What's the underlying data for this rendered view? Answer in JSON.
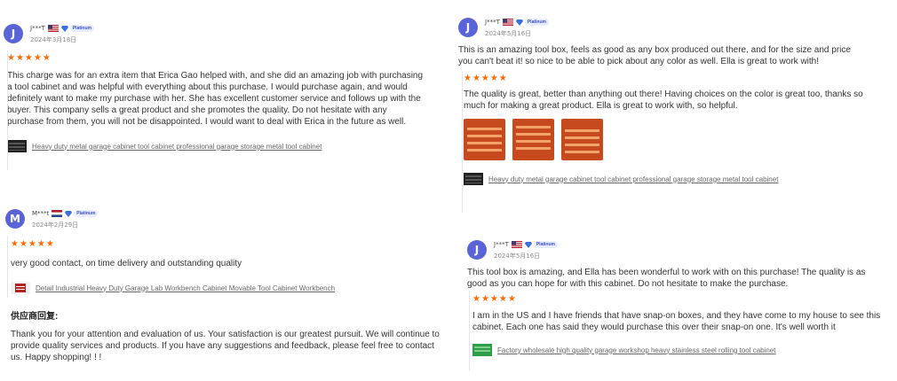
{
  "reviews": [
    {
      "id": "r1",
      "avatar_letter": "J",
      "name": "J***T",
      "flag": "us-flag",
      "badge": "Platinum",
      "date": "2024年3月18日",
      "stars": "★★★★★",
      "comment": "This charge was for an extra item that Erica Gao helped with, and she did an amazing job with purchasing a tool cabinet and was helpful with everything about this purchase. I would purchase again, and would definitely want to make my purchase with her. She has excellent customer service and follows up with the buyer. This company sells a great product and she promotes the quality. Do not hesitate with any purchase from them, you will not be disappointed. I would want to deal with Erica in the future as well.",
      "product": "Heavy duty metal garage cabinet tool cabinet professional garage storage metal tool cabinet"
    },
    {
      "id": "r2",
      "avatar_letter": "J",
      "name": "J***T",
      "flag": "us-flag",
      "badge": "Platinum",
      "date": "2024年5月16日",
      "supplier_comment": "This is an amazing tool box, feels as good as any box produced out there, and for the size and price you can't beat it! so nice to be able to pick about any color as well. Ella is great to work with!",
      "stars": "★★★★★",
      "comment": "The quality is great, better than anything out there! Having choices on the color is great too, thanks so much for making a great product. Ella is great to work with, so helpful.",
      "product": "Heavy duty metal garage cabinet tool cabinet professional garage storage metal tool cabinet"
    },
    {
      "id": "r3",
      "avatar_letter": "M",
      "name": "M***t",
      "flag": "nl-flag",
      "badge": "Platinum",
      "date": "2024年2月29日",
      "stars": "★★★★★",
      "comment": "very good contact, on time delivery and outstanding quality",
      "product": "Detail Industrial Heavy Duty Garage Lab Workbench Cabinet Movable Tool Cabinet Workbench",
      "supplier_reply_title": "供应商回复:",
      "supplier_reply": "Thank you for your attention and evaluation of us. Your satisfaction is our greatest pursuit. We will continue to provide quality services and products. If you have any suggestions and feedback, please feel free to contact us. Happy shopping! ! !"
    },
    {
      "id": "r4",
      "avatar_letter": "J",
      "name": "J***T",
      "flag": "us-flag",
      "badge": "Platinum",
      "date": "2024年5月16日",
      "supplier_comment": "This tool box is amazing, and Ella has been wonderful to work with on this purchase! The quality is as good as you can hope for with this cabinet. Do not hesitate to make the purchase.",
      "stars": "★★★★★",
      "comment": "I am in the US and I have friends that have snap-on boxes, and they have come to my house to see this cabinet. Each one has said they would purchase this over their snap-on one. It's well worth it",
      "product": "Factory wholesale high quality garage workshop heavy stainless steel rolling tool cabinet"
    }
  ],
  "colors": {
    "avatar": "#5a64d6",
    "star": "#ff6a00",
    "cabinet_orange": "#c74a1e",
    "cabinet_green": "#2e9e4a",
    "cabinet_red": "#b22222",
    "cabinet_black": "#222222"
  }
}
